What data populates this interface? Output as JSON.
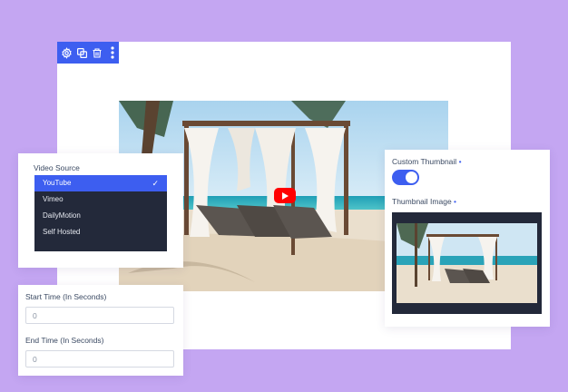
{
  "toolbar": {
    "icons": [
      "gear-icon",
      "duplicate-icon",
      "trash-icon",
      "more-vertical-icon"
    ],
    "accent": "#3d5ef0"
  },
  "video": {
    "play_icon": "youtube-play-icon",
    "play_color": "#ff0000"
  },
  "video_source": {
    "label": "Video Source",
    "selected": "YouTube",
    "options": [
      "YouTube",
      "Vimeo",
      "DailyMotion",
      "Self Hosted"
    ],
    "check_icon": "check-icon"
  },
  "time": {
    "start_label": "Start Time (In Seconds)",
    "start_value": "0",
    "end_label": "End Time (In Seconds)",
    "end_value": "0"
  },
  "thumbnail": {
    "custom_label": "Custom Thumbnail",
    "custom_enabled": true,
    "image_label": "Thumbnail Image",
    "required_marker": "•"
  },
  "colors": {
    "background": "#c4a6f2",
    "accent": "#3d5ef0",
    "dropdown_bg": "#23293a"
  }
}
